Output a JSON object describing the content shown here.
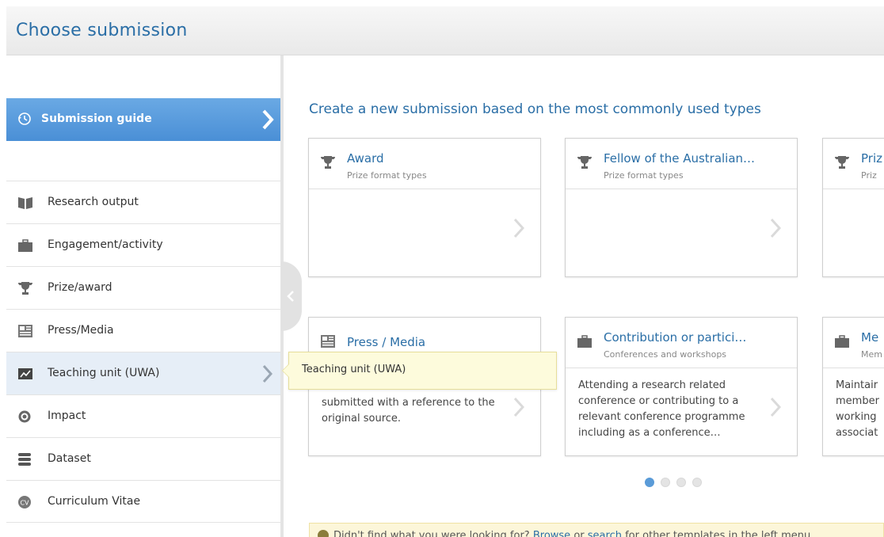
{
  "header": {
    "title": "Choose submission"
  },
  "sidebar": {
    "guide": {
      "label": "Submission guide"
    },
    "items": [
      {
        "label": "Research output",
        "icon": "book-icon"
      },
      {
        "label": "Engagement/activity",
        "icon": "briefcase-icon"
      },
      {
        "label": "Prize/award",
        "icon": "trophy-icon"
      },
      {
        "label": "Press/Media",
        "icon": "newspaper-icon"
      },
      {
        "label": "Teaching unit (UWA)",
        "icon": "chart-icon"
      },
      {
        "label": "Impact",
        "icon": "target-icon"
      },
      {
        "label": "Dataset",
        "icon": "database-icon"
      },
      {
        "label": "Curriculum Vitae",
        "icon": "cv-icon"
      }
    ]
  },
  "tooltip": {
    "text": "Teaching unit (UWA)"
  },
  "main": {
    "title": "Create a new submission based on the most commonly used types",
    "cards": [
      {
        "title": "Award",
        "subtitle": "Prize format types",
        "body": ""
      },
      {
        "title": "Fellow of the Australian…",
        "subtitle": "Prize format types",
        "body": ""
      },
      {
        "title": "Priz",
        "subtitle": "Priz",
        "body": ""
      },
      {
        "title": "Press / Media",
        "subtitle": "",
        "body": "submitted with a reference to the original source."
      },
      {
        "title": "Contribution or partici…",
        "subtitle": "Conferences and workshops",
        "body": "Attending a research related conference or contributing to a relevant conference programme including as a conference…"
      },
      {
        "title": "Me",
        "subtitle": "Mem",
        "body": "Maintair member working associat"
      }
    ],
    "pagination": {
      "pages": 4,
      "current": 1
    }
  },
  "notice": {
    "prefix": "Didn't find what you were looking for?",
    "browse": "Browse",
    "or": "or",
    "search": "search",
    "suffix": "for other templates in the left menu"
  },
  "colors": {
    "accent": "#2a6ea6",
    "guide": "#4a8fd6",
    "tooltip_bg": "#fdfbdc"
  }
}
